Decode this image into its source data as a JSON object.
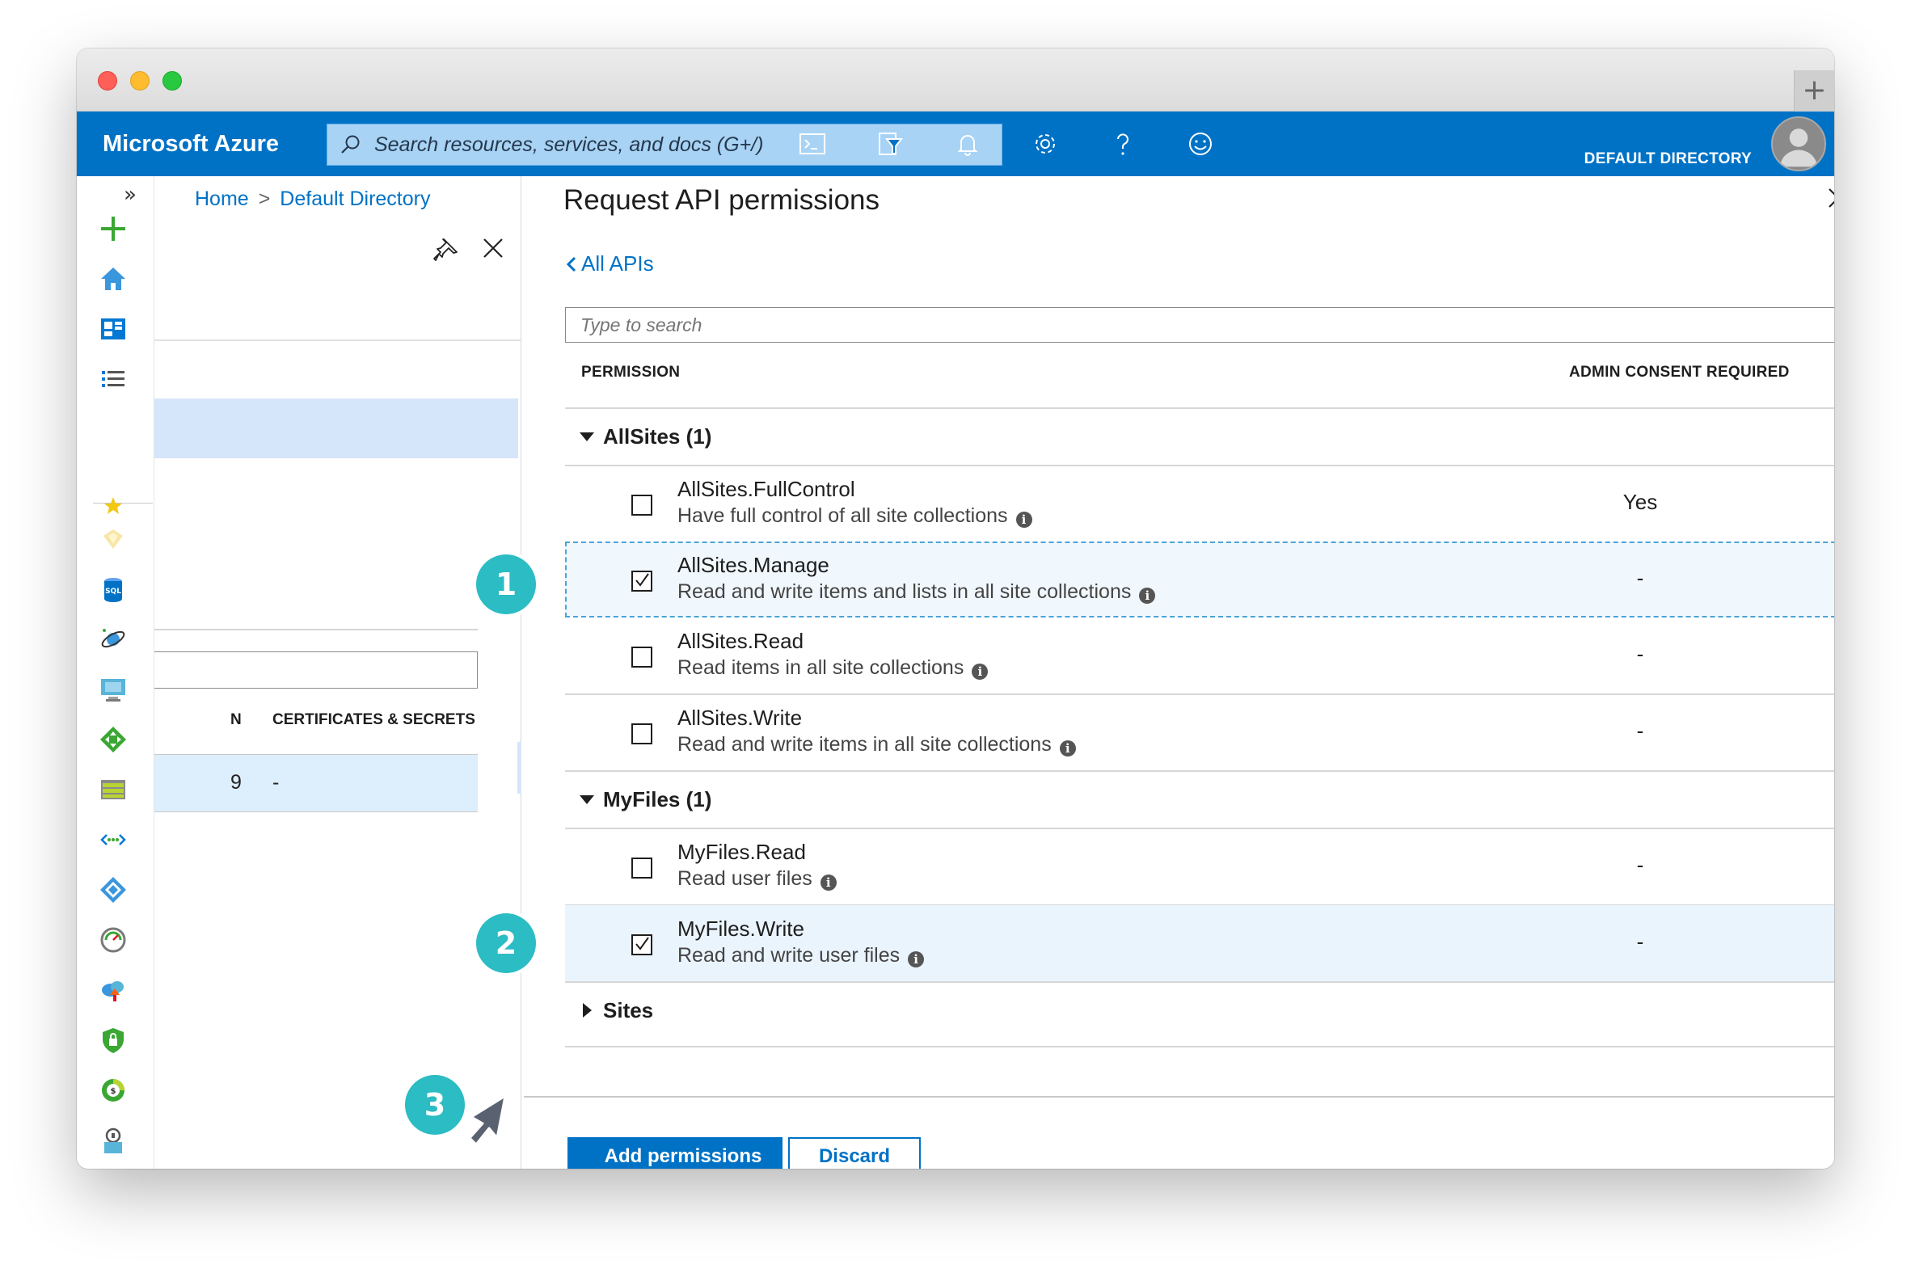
{
  "window": {
    "new_tab": "+"
  },
  "topbar": {
    "brand": "Microsoft Azure",
    "search_placeholder": "Search resources, services, and docs (G+/)",
    "directory": "DEFAULT DIRECTORY",
    "icons": [
      "cloud-shell-icon",
      "directory-filter-icon",
      "notifications-icon",
      "settings-icon",
      "help-icon",
      "feedback-icon"
    ]
  },
  "leftnav": {
    "expand": "»",
    "icons": [
      "create-resource-icon",
      "home-icon",
      "dashboard-icon",
      "all-services-icon",
      "favorites-star-icon",
      "all-resources-icon",
      "sql-database-icon",
      "cosmos-db-icon",
      "virtual-machines-icon",
      "load-balancers-icon",
      "storage-accounts-icon",
      "virtual-networks-icon",
      "azure-ad-icon",
      "monitor-icon",
      "advisor-icon",
      "security-center-icon",
      "cost-management-icon",
      "help-support-icon"
    ]
  },
  "background_blade": {
    "breadcrumb": [
      "Home",
      "Default Directory"
    ],
    "breadcrumb_sep": ">",
    "col_partial": "N",
    "col_certs": "CERTIFICATES & SECRETS",
    "row_partial": "9",
    "row_value": "-"
  },
  "panel": {
    "title": "Request API permissions",
    "back_link": "All APIs",
    "search_placeholder": "Type to search",
    "col_permission": "PERMISSION",
    "col_admin": "ADMIN CONSENT REQUIRED",
    "groups": [
      {
        "label": "AllSites (1)",
        "expanded": true,
        "permissions": [
          {
            "name": "AllSites.FullControl",
            "desc": "Have full control of all site collections",
            "admin": "Yes",
            "checked": false
          },
          {
            "name": "AllSites.Manage",
            "desc": "Read and write items and lists in all site collections",
            "admin": "-",
            "checked": true
          },
          {
            "name": "AllSites.Read",
            "desc": "Read items in all site collections",
            "admin": "-",
            "checked": false
          },
          {
            "name": "AllSites.Write",
            "desc": "Read and write items in all site collections",
            "admin": "-",
            "checked": false
          }
        ]
      },
      {
        "label": "MyFiles (1)",
        "expanded": true,
        "permissions": [
          {
            "name": "MyFiles.Read",
            "desc": "Read user files",
            "admin": "-",
            "checked": false
          },
          {
            "name": "MyFiles.Write",
            "desc": "Read and write user files",
            "admin": "-",
            "checked": true
          }
        ]
      },
      {
        "label": "Sites",
        "expanded": false,
        "permissions": []
      }
    ],
    "info_glyph": "i",
    "add_button": "Add permissions",
    "discard_button": "Discard"
  },
  "callouts": {
    "one": "1",
    "two": "2",
    "three": "3"
  },
  "colors": {
    "azure_blue": "#0072c6",
    "callout_teal": "#2bbcc4",
    "selected_row": "#eaf4fc"
  }
}
